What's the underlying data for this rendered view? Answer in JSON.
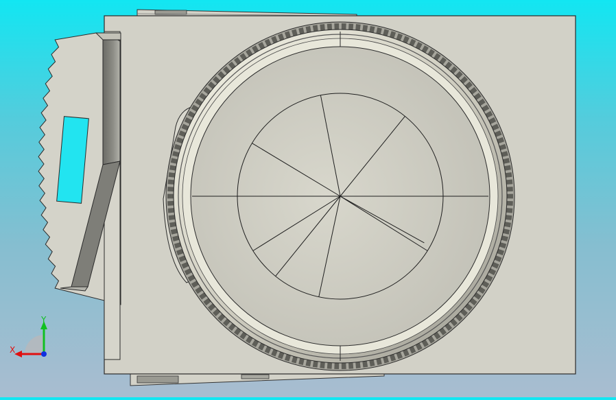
{
  "viewport": {
    "background_top": "#12e6f2",
    "background_bottom": "#a9bdd0",
    "part_face_color": "#cfcec4",
    "edge_color": "#1e1e1e",
    "cutout_color": "#22e4f0"
  },
  "triad": {
    "x_label": "X",
    "y_label": "Y",
    "x_color": "#e01010",
    "y_color": "#10c020",
    "z_color": "#1030e0"
  },
  "model": {
    "ring_teeth": 150,
    "rim_teeth": 17,
    "inner_circle_spokes": 7
  }
}
